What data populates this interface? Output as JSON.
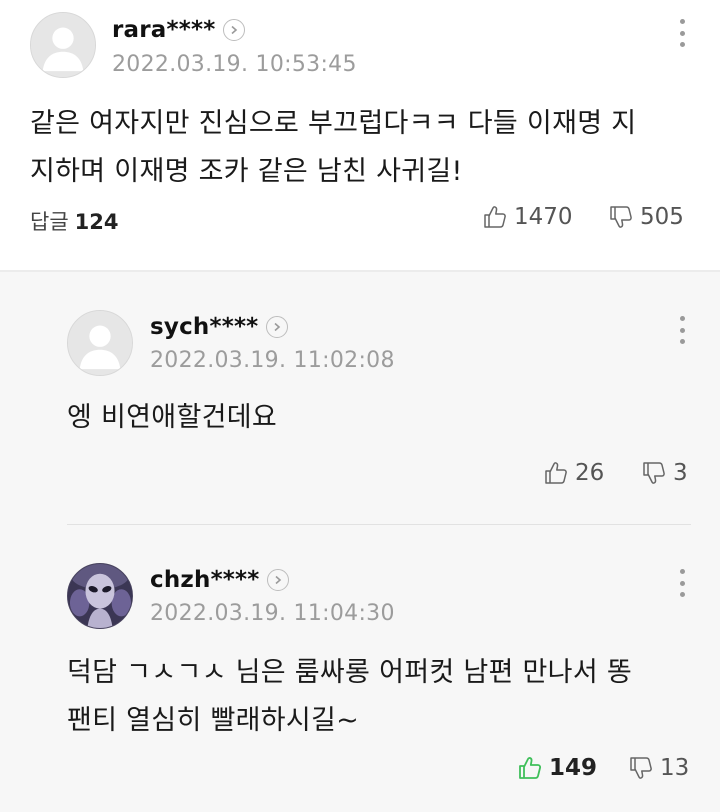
{
  "comments": [
    {
      "nickname": "rara****",
      "date": "2022.03.19. 10:53:45",
      "lines": [
        "같은 여자지만 진심으로 부끄럽다ㅋㅋ 다들 이재명 지",
        "지하며 이재명 조카 같은 남친 사귀길!"
      ],
      "reply_label": "답글",
      "reply_count": "124",
      "likes": "1470",
      "dislikes": "505",
      "avatar": "default-user-icon"
    }
  ],
  "replies": [
    {
      "nickname": "sych****",
      "date": "2022.03.19. 11:02:08",
      "lines": [
        "엥 비연애할건데요"
      ],
      "likes": "26",
      "dislikes": "3",
      "avatar": "default-user-icon"
    },
    {
      "nickname": "chzh****",
      "date": "2022.03.19. 11:04:30",
      "lines": [
        "덕담 ㄱㅅㄱㅅ 님은 룸싸롱 어퍼컷 남편 만나서 똥",
        "팬티 열심히 빨래하시길~"
      ],
      "likes": "149",
      "dislikes": "13",
      "avatar": "alien-avatar",
      "liked": true
    }
  ],
  "colors": {
    "accent_like": "#3fbf5a",
    "reply_bg": "#f7f7f7",
    "meta_gray": "#9c9c9c"
  }
}
